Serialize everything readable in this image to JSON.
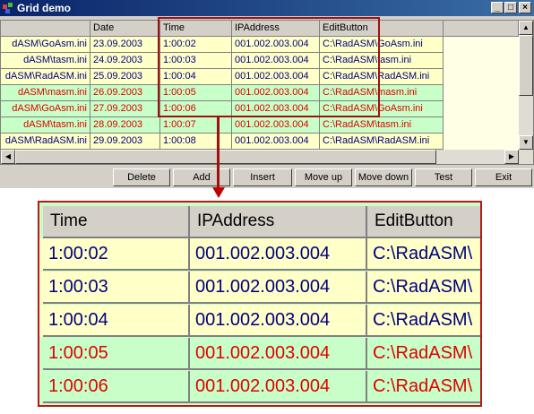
{
  "window": {
    "title": "Grid demo"
  },
  "grid": {
    "columns": [
      "",
      "Date",
      "Time",
      "IPAddress",
      "EditButton"
    ],
    "rows": [
      {
        "file": "dASM\\GoAsm.ini",
        "date": "23.09.2003",
        "time": "1:00:02",
        "ip": "001.002.003.004",
        "path": "C:\\RadASM\\GoAsm.ini",
        "color": "yellow"
      },
      {
        "file": "dASM\\tasm.ini",
        "date": "24.09.2003",
        "time": "1:00:03",
        "ip": "001.002.003.004",
        "path": "C:\\RadASM\\tasm.ini",
        "color": "yellow"
      },
      {
        "file": "dASM\\RadASM.ini",
        "date": "25.09.2003",
        "time": "1:00:04",
        "ip": "001.002.003.004",
        "path": "C:\\RadASM\\RadASM.ini",
        "color": "yellow"
      },
      {
        "file": "dASM\\masm.ini",
        "date": "26.09.2003",
        "time": "1:00:05",
        "ip": "001.002.003.004",
        "path": "C:\\RadASM\\masm.ini",
        "color": "green"
      },
      {
        "file": "dASM\\GoAsm.ini",
        "date": "27.09.2003",
        "time": "1:00:06",
        "ip": "001.002.003.004",
        "path": "C:\\RadASM\\GoAsm.ini",
        "color": "green"
      },
      {
        "file": "dASM\\tasm.ini",
        "date": "28.09.2003",
        "time": "1:00:07",
        "ip": "001.002.003.004",
        "path": "C:\\RadASM\\tasm.ini",
        "color": "green"
      },
      {
        "file": "dASM\\RadASM.ini",
        "date": "29.09.2003",
        "time": "1:00:08",
        "ip": "001.002.003.004",
        "path": "C:\\RadASM\\RadASM.ini",
        "color": "yellow"
      }
    ]
  },
  "buttons": {
    "delete": "Delete",
    "add": "Add",
    "insert": "Insert",
    "move_up": "Move up",
    "move_down": "Move down",
    "test": "Test",
    "exit": "Exit"
  },
  "zoom": {
    "columns": [
      "Time",
      "IPAddress",
      "EditButton"
    ],
    "rows": [
      {
        "time": "1:00:02",
        "ip": "001.002.003.004",
        "path": "C:\\RadASM\\",
        "color": "yellow"
      },
      {
        "time": "1:00:03",
        "ip": "001.002.003.004",
        "path": "C:\\RadASM\\",
        "color": "yellow"
      },
      {
        "time": "1:00:04",
        "ip": "001.002.003.004",
        "path": "C:\\RadASM\\",
        "color": "yellow"
      },
      {
        "time": "1:00:05",
        "ip": "001.002.003.004",
        "path": "C:\\RadASM\\",
        "color": "green"
      },
      {
        "time": "1:00:06",
        "ip": "001.002.003.004",
        "path": "C:\\RadASM\\",
        "color": "green"
      }
    ]
  },
  "colors": {
    "yellow_row": "#ffffc8",
    "green_row": "#c8ffc8",
    "red_text": "#e00000",
    "blue_text": "#000080",
    "highlight": "#a01010"
  }
}
